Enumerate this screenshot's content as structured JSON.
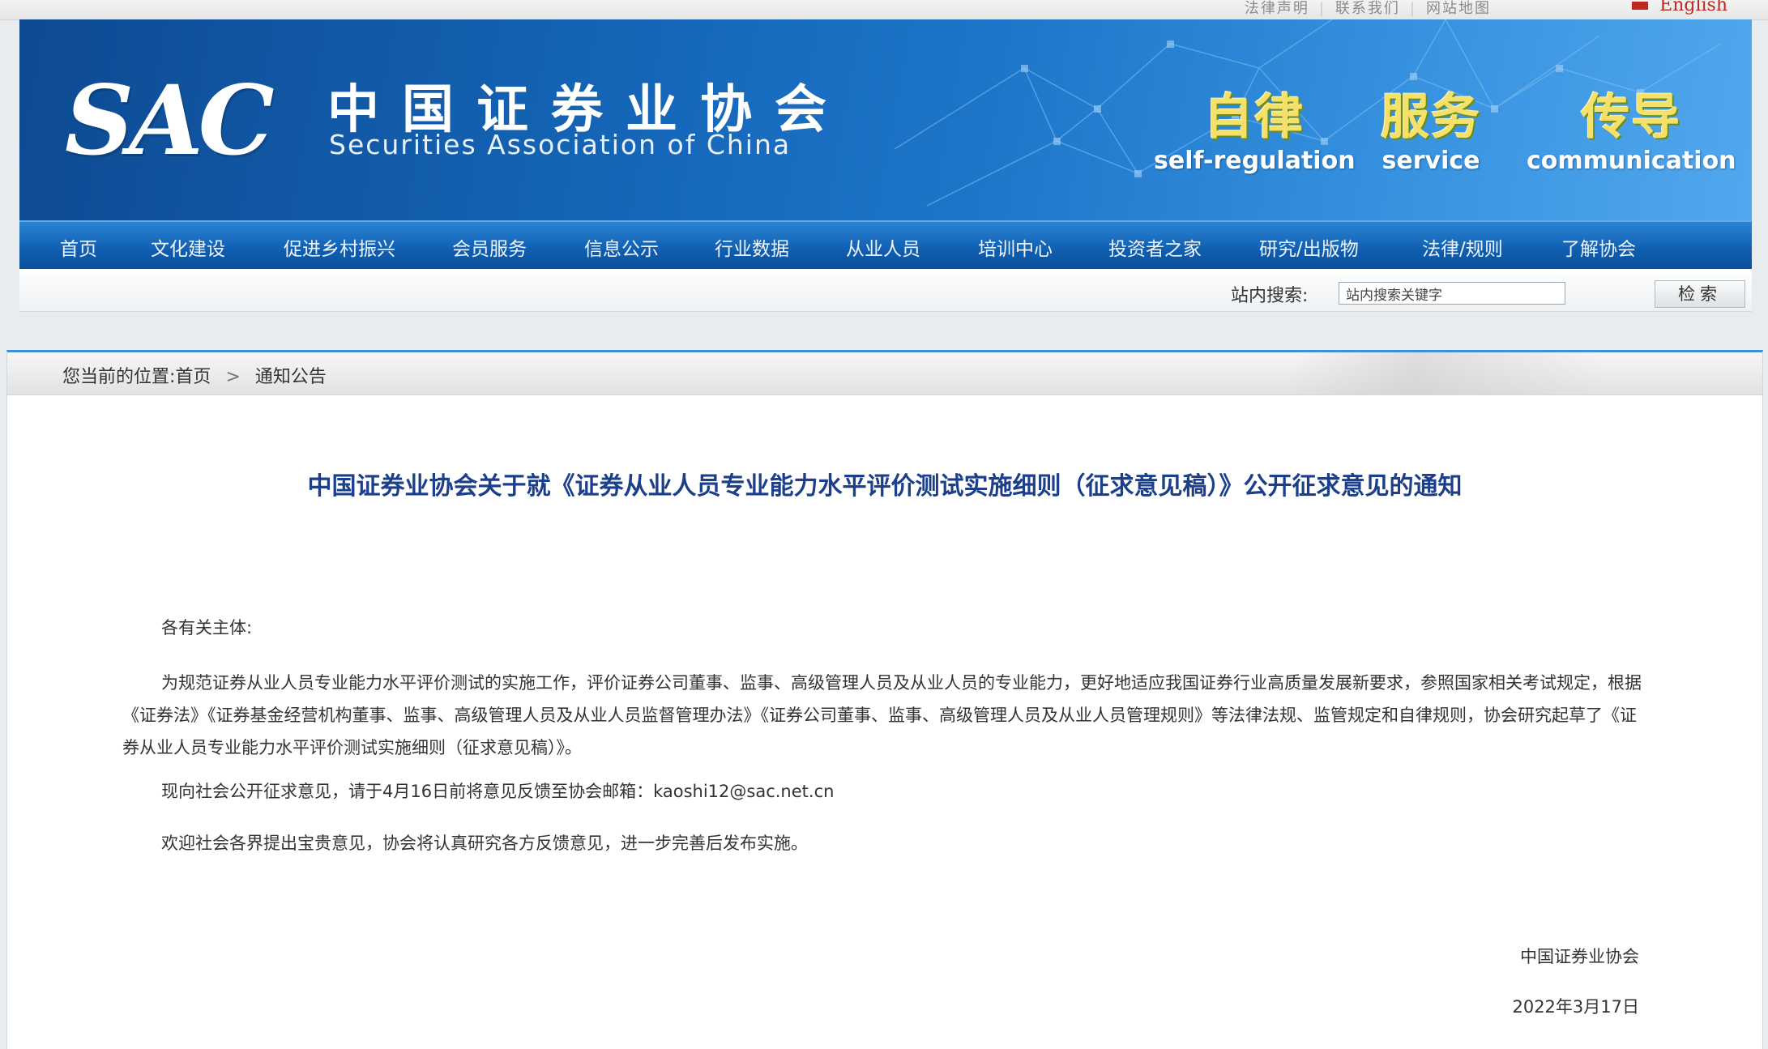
{
  "top_links": [
    "法律声明",
    "联系我们",
    "网站地图"
  ],
  "english_link": "English",
  "banner": {
    "logo": "SAC",
    "title_cn": "中国证券业协会",
    "title_en": "Securities Association of China",
    "motto": [
      {
        "zh": "自律",
        "en": "self-regulation"
      },
      {
        "zh": "服务",
        "en": "service"
      },
      {
        "zh": "传导",
        "en": "communication"
      }
    ]
  },
  "nav": [
    "首页",
    "文化建设",
    "促进乡村振兴",
    "会员服务",
    "信息公示",
    "行业数据",
    "从业人员",
    "培训中心",
    "投资者之家",
    "研究/出版物",
    "法律/规则",
    "了解协会"
  ],
  "search": {
    "label": "站内搜索:",
    "placeholder": "站内搜索关键字",
    "button": "检索"
  },
  "breadcrumb": {
    "prefix": "您当前的位置:",
    "home": "首页",
    "separator": ">",
    "current": "通知公告"
  },
  "article": {
    "title": "中国证券业协会关于就《证券从业人员专业能力水平评价测试实施细则（征求意见稿）》公开征求意见的通知",
    "salutation": "各有关主体:",
    "body": "为规范证券从业人员专业能力水平评价测试的实施工作，评价证券公司董事、监事、高级管理人员及从业人员的专业能力，更好地适应我国证券行业高质量发展新要求，参照国家相关考试规定，根据《证券法》《证券基金经营机构董事、监事、高级管理人员及从业人员监督管理办法》《证券公司董事、监事、高级管理人员及从业人员管理规则》等法律法规、监管规定和自律规则，协会研究起草了《证券从业人员专业能力水平评价测试实施细则（征求意见稿）》。",
    "p2": "现向社会公开征求意见，请于4月16日前将意见反馈至协会邮箱：kaoshi12@sac.net.cn",
    "p3": "欢迎社会各界提出宝贵意见，协会将认真研究各方反馈意见，进一步完善后发布实施。",
    "signature": "中国证券业协会",
    "date": "2022年3月17日"
  }
}
